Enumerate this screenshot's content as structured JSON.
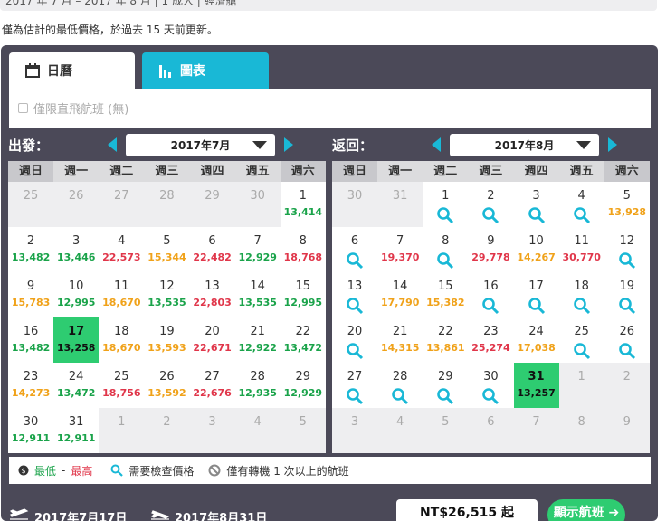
{
  "topbar": {
    "text": "2017 年 7 月 – 2017 年 8 月 | 1 成人 | 經濟艙"
  },
  "note": "僅為估計的最低價格，於過去 15 天前更新。",
  "tabs": {
    "calendar": "日曆",
    "chart": "圖表"
  },
  "filter": {
    "label": "僅限直飛航班 (無)"
  },
  "depart": {
    "label": "出發：",
    "month": "2017年7月",
    "weekdays": [
      "週日",
      "週一",
      "週二",
      "週三",
      "週四",
      "週五",
      "週六"
    ],
    "days": [
      {
        "d": "25",
        "out": true
      },
      {
        "d": "26",
        "out": true
      },
      {
        "d": "27",
        "out": true
      },
      {
        "d": "28",
        "out": true
      },
      {
        "d": "29",
        "out": true
      },
      {
        "d": "30",
        "out": true
      },
      {
        "d": "1",
        "p": "13,414",
        "c": "green"
      },
      {
        "d": "2",
        "p": "13,482",
        "c": "green"
      },
      {
        "d": "3",
        "p": "13,446",
        "c": "green"
      },
      {
        "d": "4",
        "p": "22,573",
        "c": "red"
      },
      {
        "d": "5",
        "p": "15,344",
        "c": "orange"
      },
      {
        "d": "6",
        "p": "22,482",
        "c": "red"
      },
      {
        "d": "7",
        "p": "12,929",
        "c": "green"
      },
      {
        "d": "8",
        "p": "18,768",
        "c": "red"
      },
      {
        "d": "9",
        "p": "15,783",
        "c": "orange"
      },
      {
        "d": "10",
        "p": "12,995",
        "c": "green"
      },
      {
        "d": "11",
        "p": "18,670",
        "c": "orange"
      },
      {
        "d": "12",
        "p": "13,535",
        "c": "green"
      },
      {
        "d": "13",
        "p": "22,803",
        "c": "red"
      },
      {
        "d": "14",
        "p": "13,535",
        "c": "green"
      },
      {
        "d": "15",
        "p": "12,995",
        "c": "green"
      },
      {
        "d": "16",
        "p": "13,482",
        "c": "green"
      },
      {
        "d": "17",
        "p": "13,258",
        "c": "green",
        "sel": true
      },
      {
        "d": "18",
        "p": "18,670",
        "c": "orange"
      },
      {
        "d": "19",
        "p": "13,593",
        "c": "orange"
      },
      {
        "d": "20",
        "p": "22,671",
        "c": "red"
      },
      {
        "d": "21",
        "p": "12,922",
        "c": "green"
      },
      {
        "d": "22",
        "p": "13,472",
        "c": "green"
      },
      {
        "d": "23",
        "p": "14,273",
        "c": "orange"
      },
      {
        "d": "24",
        "p": "13,472",
        "c": "green"
      },
      {
        "d": "25",
        "p": "18,756",
        "c": "red"
      },
      {
        "d": "26",
        "p": "13,592",
        "c": "orange"
      },
      {
        "d": "27",
        "p": "22,676",
        "c": "red"
      },
      {
        "d": "28",
        "p": "12,935",
        "c": "green"
      },
      {
        "d": "29",
        "p": "12,929",
        "c": "green"
      },
      {
        "d": "30",
        "p": "12,911",
        "c": "green"
      },
      {
        "d": "31",
        "p": "12,911",
        "c": "green"
      },
      {
        "d": "1",
        "out": true
      },
      {
        "d": "2",
        "out": true
      },
      {
        "d": "3",
        "out": true
      },
      {
        "d": "4",
        "out": true
      },
      {
        "d": "5",
        "out": true
      }
    ]
  },
  "return": {
    "label": "返回：",
    "month": "2017年8月",
    "weekdays": [
      "週日",
      "週一",
      "週二",
      "週三",
      "週四",
      "週五",
      "週六"
    ],
    "days": [
      {
        "d": "30",
        "out": true
      },
      {
        "d": "31",
        "out": true
      },
      {
        "d": "1",
        "q": true
      },
      {
        "d": "2",
        "q": true
      },
      {
        "d": "3",
        "q": true
      },
      {
        "d": "4",
        "q": true
      },
      {
        "d": "5",
        "p": "13,928",
        "c": "orange"
      },
      {
        "d": "6",
        "q": true
      },
      {
        "d": "7",
        "p": "19,370",
        "c": "red"
      },
      {
        "d": "8",
        "q": true
      },
      {
        "d": "9",
        "p": "29,778",
        "c": "red"
      },
      {
        "d": "10",
        "p": "14,267",
        "c": "orange"
      },
      {
        "d": "11",
        "p": "30,770",
        "c": "red"
      },
      {
        "d": "12",
        "q": true
      },
      {
        "d": "13",
        "q": true
      },
      {
        "d": "14",
        "p": "17,790",
        "c": "orange"
      },
      {
        "d": "15",
        "p": "15,382",
        "c": "orange"
      },
      {
        "d": "16",
        "q": true
      },
      {
        "d": "17",
        "q": true
      },
      {
        "d": "18",
        "q": true
      },
      {
        "d": "19",
        "q": true
      },
      {
        "d": "20",
        "q": true
      },
      {
        "d": "21",
        "p": "14,315",
        "c": "orange"
      },
      {
        "d": "22",
        "p": "13,861",
        "c": "orange"
      },
      {
        "d": "23",
        "p": "25,274",
        "c": "red"
      },
      {
        "d": "24",
        "p": "17,038",
        "c": "orange"
      },
      {
        "d": "25",
        "q": true
      },
      {
        "d": "26",
        "q": true
      },
      {
        "d": "27",
        "q": true
      },
      {
        "d": "28",
        "q": true
      },
      {
        "d": "29",
        "q": true
      },
      {
        "d": "30",
        "q": true
      },
      {
        "d": "31",
        "p": "13,257",
        "c": "green",
        "sel": true
      },
      {
        "d": "1",
        "out": true
      },
      {
        "d": "2",
        "out": true
      },
      {
        "d": "3",
        "out": true
      },
      {
        "d": "4",
        "out": true
      },
      {
        "d": "5",
        "out": true
      },
      {
        "d": "6",
        "out": true
      },
      {
        "d": "7",
        "out": true
      },
      {
        "d": "8",
        "out": true
      },
      {
        "d": "9",
        "out": true
      }
    ]
  },
  "legend": {
    "low": "最低",
    "dash": "-",
    "high": "最高",
    "check": "需要檢查價格",
    "transfer": "僅有轉機 1 次以上的航班"
  },
  "footer": {
    "depart_date": "2017年7月17日",
    "return_date": "2017年8月31日",
    "price": "NT$26,515 起",
    "show": "顯示航班 ➔"
  },
  "colors": {
    "panel": "#4b4958",
    "accent": "#19b8d6",
    "green": "#2ecc71"
  }
}
